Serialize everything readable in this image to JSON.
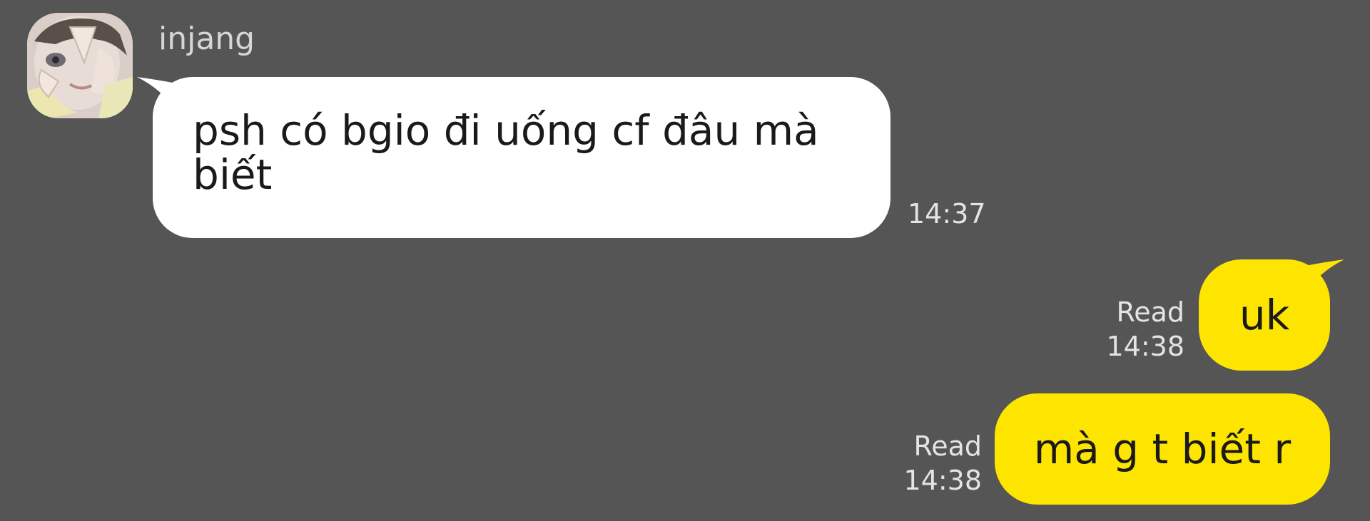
{
  "chat": {
    "contact_name": "injang",
    "messages": [
      {
        "direction": "incoming",
        "text": "psh có bgio đi uống cf đâu mà biết",
        "time": "14:37"
      },
      {
        "direction": "outgoing",
        "text": "uk",
        "status": "Read",
        "time": "14:38"
      },
      {
        "direction": "outgoing",
        "text": "mà g t biết r",
        "status": "Read",
        "time": "14:38"
      }
    ]
  },
  "colors": {
    "background": "#555555",
    "incoming_bubble": "#ffffff",
    "outgoing_bubble": "#fee500",
    "meta_text": "#e4e4e4",
    "name_text": "#d6d6d6"
  },
  "icons": {
    "avatar": "contact-avatar-photo"
  }
}
